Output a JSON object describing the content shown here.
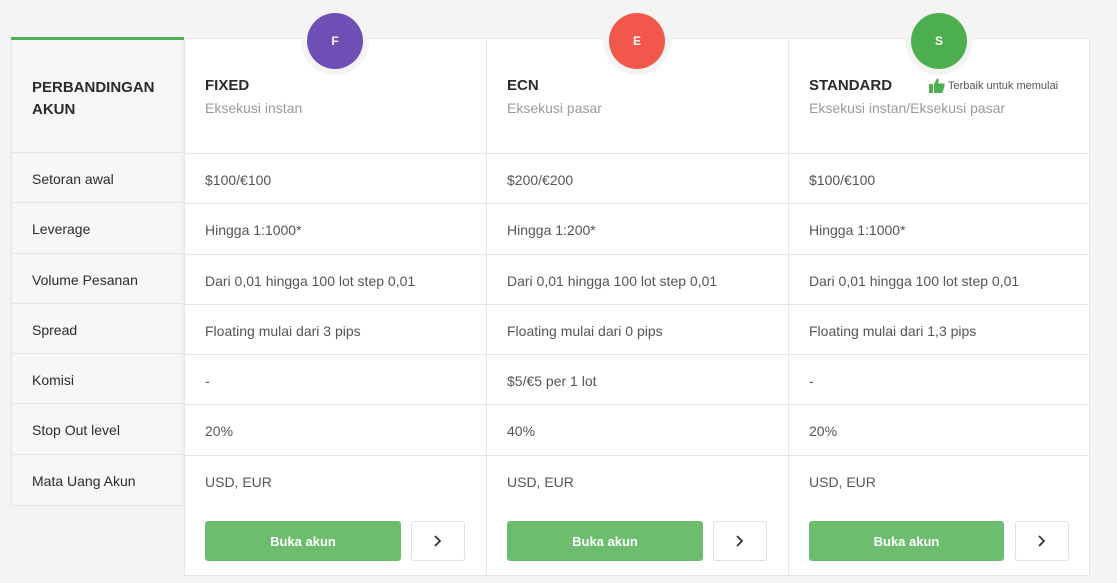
{
  "header": {
    "title": "PERBANDINGAN AKUN"
  },
  "rows": [
    "Setoran awal",
    "Leverage",
    "Volume Pesanan",
    "Spread",
    "Komisi",
    "Stop Out level",
    "Mata Uang Akun"
  ],
  "accounts": [
    {
      "badge": "F",
      "badge_color": "#6f4fb5",
      "name": "FIXED",
      "subtitle": "Eksekusi instan",
      "values": [
        "$100/€100",
        "Hingga 1:1000*",
        "Dari 0,01 hingga 100 lot step 0,01",
        "Floating mulai dari 3 pips",
        "-",
        "20%",
        "USD, EUR"
      ],
      "open_label": "Buka akun"
    },
    {
      "badge": "E",
      "badge_color": "#f1574b",
      "name": "ECN",
      "subtitle": "Eksekusi pasar",
      "values": [
        "$200/€200",
        "Hingga 1:200*",
        "Dari 0,01 hingga 100 lot step 0,01",
        "Floating mulai dari 0 pips",
        "$5/€5 per 1 lot",
        "40%",
        "USD, EUR"
      ],
      "open_label": "Buka akun"
    },
    {
      "badge": "S",
      "badge_color": "#4cae4f",
      "name": "STANDARD",
      "subtitle": "Eksekusi instan/Eksekusi pasar",
      "best_label": "Terbaik untuk memulai",
      "values": [
        "$100/€100",
        "Hingga 1:1000*",
        "Dari 0,01 hingga 100 lot step 0,01",
        "Floating mulai dari 1,3 pips",
        "-",
        "20%",
        "USD, EUR"
      ],
      "open_label": "Buka akun"
    }
  ],
  "colors": {
    "accent": "#4caf50",
    "button": "#6cbe6e"
  }
}
